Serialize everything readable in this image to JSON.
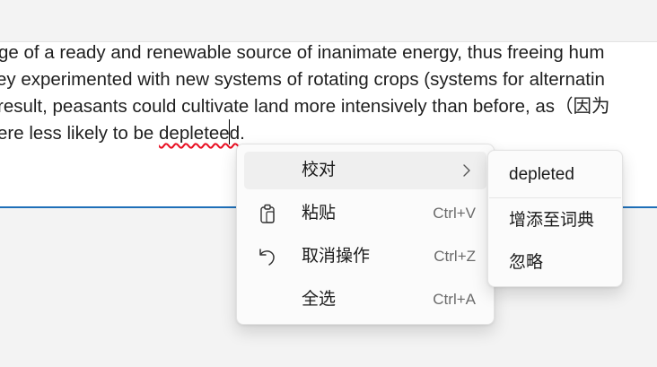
{
  "document": {
    "lines": [
      "ge of a ready and renewable source of inanimate energy, thus freeing hum",
      "ey experimented with new systems of rotating crops (systems for alternatin",
      " result, peasants could cultivate land more intensively than before, as（因为",
      "ere less likely to be "
    ],
    "misspelled_word": "depleteed",
    "line4_tail": "."
  },
  "context_menu": {
    "items": [
      {
        "label": "校对",
        "shortcut": "",
        "icon": "none",
        "has_submenu": true
      },
      {
        "label": "粘贴",
        "shortcut": "Ctrl+V",
        "icon": "clipboard-icon"
      },
      {
        "label": "取消操作",
        "shortcut": "Ctrl+Z",
        "icon": "undo-icon"
      },
      {
        "label": "全选",
        "shortcut": "Ctrl+A",
        "icon": "none"
      }
    ]
  },
  "proofing_submenu": {
    "suggestion": "depleted",
    "add_to_dictionary": "增添至词典",
    "ignore": "忽略"
  },
  "colors": {
    "focus_underline": "#1e6fb8",
    "spelling_error": "#e81123",
    "menu_background": "#fbfbfb",
    "highlight": "#efefef"
  }
}
